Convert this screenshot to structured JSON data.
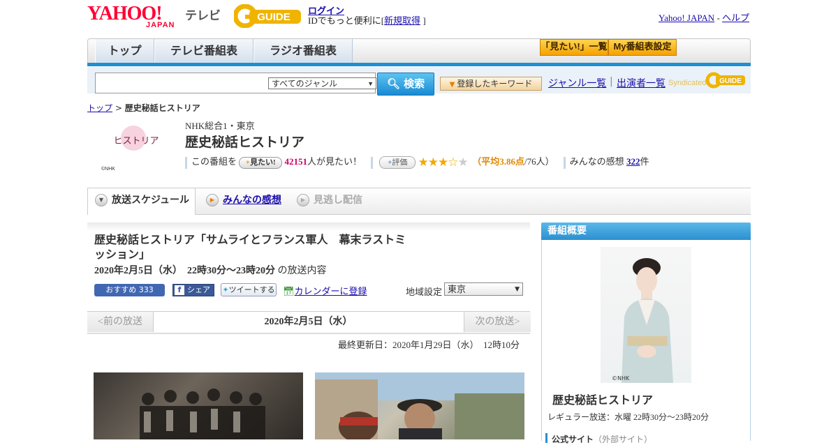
{
  "header": {
    "logo_text": "YAHOO!",
    "logo_sub": "JAPAN",
    "tv_label": "テレビ",
    "gguide_logo": "GUIDE",
    "login_link": "ログイン",
    "login_note_prefix": "IDでもっと便利に[",
    "signup_link": "新規取得",
    "login_note_suffix": "]",
    "yahoo_japan_link": "Yahoo! JAPAN",
    "separator": "-",
    "help_link": "ヘルプ"
  },
  "global_nav": {
    "tabs": [
      "トップ",
      "テレビ番組表",
      "ラジオ番組表"
    ],
    "mitai_list_button": "「見たい!」一覧",
    "my_bangumi_button": "My番組表設定"
  },
  "search": {
    "input_value": "",
    "genre_select": "すべてのジャンル",
    "search_button": "検索",
    "keyword_button": "登録したキーワード",
    "genre_list_link": "ジャンル一覧",
    "separator": "|",
    "performer_list_link": "出演者一覧",
    "syndicated_label": "Syndicated",
    "syndicated_logo": "GUIDE"
  },
  "breadcrumb": {
    "top": "トップ",
    "sep": ">",
    "current": "歴史秘話ヒストリア"
  },
  "program": {
    "thumb_text": "ヒストリア",
    "thumb_credit": "©NHK",
    "channel": "NHK総合1・東京",
    "title": "歴史秘話ヒストリア",
    "mitai_prefix": "この番組を",
    "mitai_button": "見たい!",
    "mitai_count": "42151",
    "mitai_suffix": "人が見たい！",
    "hyouka_button": "評価",
    "rating": 3.86,
    "rating_open": "（",
    "rating_avg": "平均3.86点",
    "rating_count": "/76人）",
    "kansou_prefix": "みんなの感想",
    "kansou_count": "322",
    "kansou_suffix": "件"
  },
  "content_tabs": {
    "schedule": "放送スケジュール",
    "kansou": "みんなの感想",
    "minogashi": "見逃し配信"
  },
  "episode": {
    "title": "歴史秘話ヒストリア「サムライとフランス軍人　幕末ラストミッション」",
    "date_bold": "2020年2月5日（水）　22時30分～23時20分",
    "date_suffix": "の放送内容",
    "fb_recommend": "おすすめ 333",
    "fb_share": "シェア",
    "tweet": "ツイートする",
    "calendar_link": "カレンダーに登録",
    "region_label": "地域設定",
    "region_value": "東京",
    "prev": "<前の放送",
    "pager_date": "2020年2月5日（水）",
    "next": "次の放送>",
    "last_updated": "最終更新日：2020年1月29日（水）　12時10分"
  },
  "sidebar": {
    "header": "番組概要",
    "photo_credit": "©NHK",
    "title": "歴史秘話ヒストリア",
    "regular": "レギュラー放送：水曜 22時30分～23時20分",
    "official_site": "公式サイト",
    "official_site_ext": "（外部サイト）"
  },
  "colors": {
    "brand_red": "#ff0033",
    "nav_blue": "#1d8fd4",
    "link": "#1a0dab",
    "accent_orange": "#f4a100",
    "count_pink": "#cc0066"
  }
}
